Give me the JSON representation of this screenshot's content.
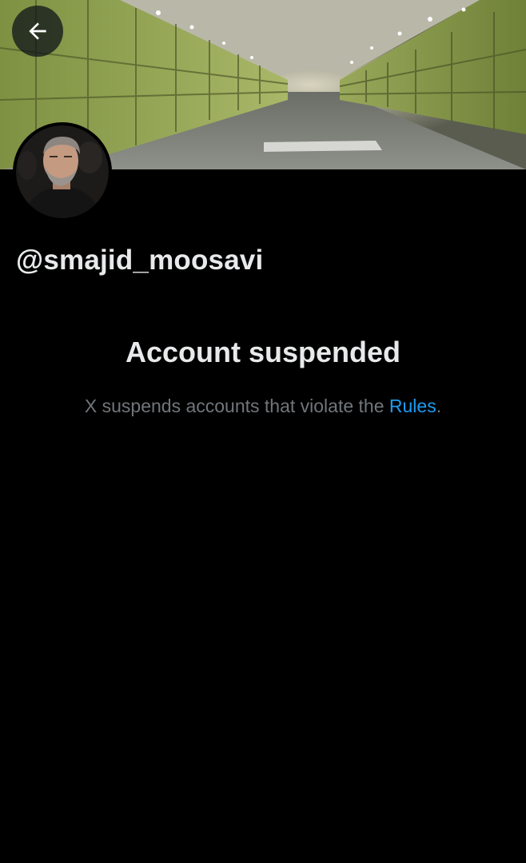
{
  "header": {
    "back_icon": "arrow-left-icon",
    "banner_description_icon": "tunnel-banner-image"
  },
  "profile": {
    "avatar_icon": "profile-photo",
    "handle": "@smajid_moosavi"
  },
  "suspension": {
    "title": "Account suspended",
    "description_prefix": "X suspends accounts that violate the ",
    "rules_link": "Rules",
    "description_suffix": "."
  },
  "colors": {
    "background": "#000000",
    "primary_text": "#e7e9ea",
    "secondary_text": "#71767b",
    "link": "#1d9bf0"
  }
}
